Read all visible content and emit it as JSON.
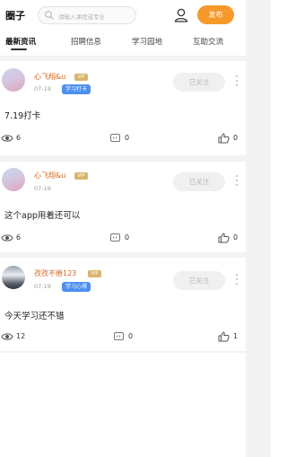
{
  "header": {
    "title": "圈子",
    "search_placeholder": "请输入课程或专业",
    "publish_label": "发布"
  },
  "tabs": [
    {
      "label": "最新资讯",
      "active": true
    },
    {
      "label": "招聘信息",
      "active": false
    },
    {
      "label": "学习园地",
      "active": false
    },
    {
      "label": "互助交流",
      "active": false
    }
  ],
  "posts": [
    {
      "username": "心飞翔&u",
      "badge": "VIP",
      "date": "07-19",
      "tag": "学习打卡",
      "follow_label": "已关注",
      "content": "7.19打卡",
      "views": "6",
      "comments": "0",
      "likes": "0"
    },
    {
      "username": "心飞翔&u",
      "badge": "VIP",
      "date": "07-19",
      "tag": "",
      "follow_label": "已关注",
      "content": "这个app用着还可以",
      "views": "6",
      "comments": "0",
      "likes": "0"
    },
    {
      "username": "孜孜不倦123",
      "badge": "VIP",
      "date": "07-19",
      "tag": "学习心得",
      "follow_label": "已关注",
      "content": "今天学习还不错",
      "views": "12",
      "comments": "0",
      "likes": "1"
    }
  ],
  "colors": {
    "accent": "#f6992b",
    "tag_blue": "#4c8ff0",
    "username": "#d4661f",
    "vip_gold": "#d8b56a"
  }
}
